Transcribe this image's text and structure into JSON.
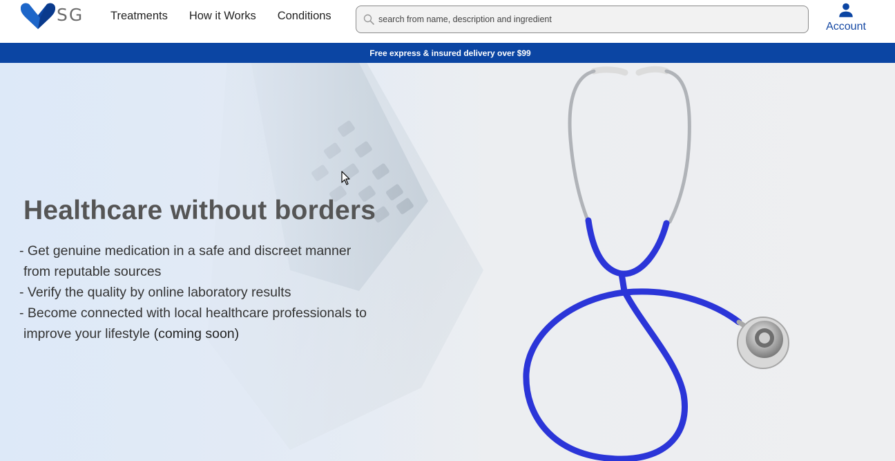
{
  "brand": {
    "logo_text": "SG",
    "primary_color": "#0b45a3"
  },
  "nav": {
    "items": [
      {
        "label": "Treatments"
      },
      {
        "label": "How it Works"
      },
      {
        "label": "Conditions"
      }
    ]
  },
  "search": {
    "placeholder": "search from name, description and ingredient",
    "icon": "search-icon"
  },
  "account": {
    "label": "Account",
    "icon": "person-icon"
  },
  "banner": {
    "text": "Free express & insured delivery over $99"
  },
  "hero": {
    "title": "Healthcare without borders",
    "bullets": {
      "b1_line1": "- Get genuine medication in a safe and discreet manner",
      "b1_line2": "from reputable sources",
      "b2": "- Verify the quality by online laboratory results",
      "b3_line1": "- Become connected with local healthcare professionals to",
      "b3_line2": "improve your lifestyle ",
      "b3_soon": "(coming soon)"
    },
    "image": "stethoscope-and-laptop-photo"
  }
}
